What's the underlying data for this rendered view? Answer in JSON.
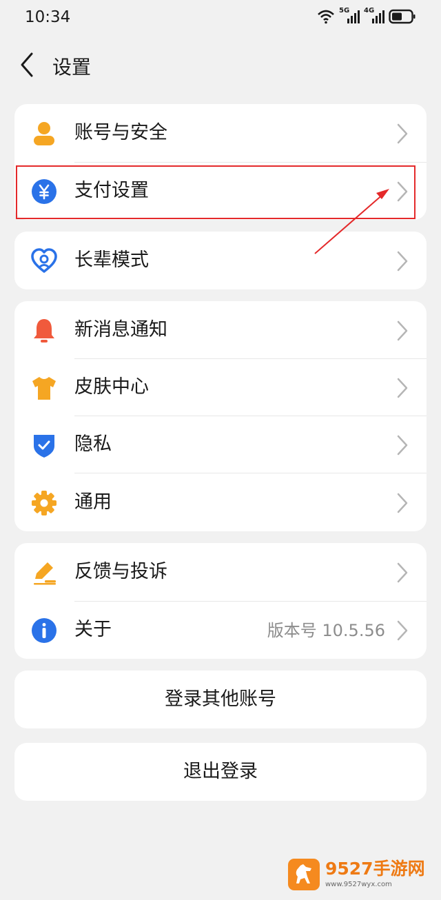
{
  "status": {
    "time": "10:34",
    "net1": "5G",
    "net2": "4G"
  },
  "nav": {
    "title": "设置"
  },
  "group1": [
    {
      "label": "账号与安全",
      "icon": "user-icon"
    },
    {
      "label": "支付设置",
      "icon": "yuan-icon"
    }
  ],
  "group2": [
    {
      "label": "长辈模式",
      "icon": "heart-icon"
    }
  ],
  "group3": [
    {
      "label": "新消息通知",
      "icon": "bell-icon"
    },
    {
      "label": "皮肤中心",
      "icon": "tshirt-icon"
    },
    {
      "label": "隐私",
      "icon": "shield-icon"
    },
    {
      "label": "通用",
      "icon": "gear-icon"
    }
  ],
  "group4": [
    {
      "label": "反馈与投诉",
      "icon": "edit-icon"
    },
    {
      "label": "关于",
      "icon": "info-icon",
      "value": "版本号 10.5.56"
    }
  ],
  "buttons": {
    "switch_account": "登录其他账号",
    "logout": "退出登录"
  },
  "watermark": {
    "brand": "9527手游网",
    "url": "www.9527wyx.com"
  },
  "colors": {
    "background": "#f1f1f1",
    "highlight": "#e4292a",
    "blue": "#2a72e8",
    "orange": "#f5a623",
    "red": "#f05a3c"
  }
}
